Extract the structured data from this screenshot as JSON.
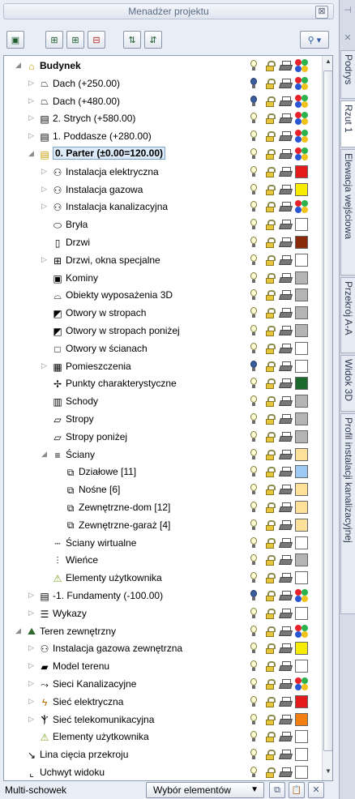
{
  "panel": {
    "title": "Menadżer projektu",
    "close_glyph": "⊠"
  },
  "toolbar": {
    "buttons": [
      "properties-icon",
      "add-green-icon",
      "add-blue-icon",
      "remove-red-icon",
      "move-up-icon",
      "move-down-icon",
      "filter-icon"
    ]
  },
  "tree": {
    "rows": [
      {
        "label": "Budynek",
        "level": 0,
        "toggle": "◢",
        "bold": true,
        "icon": "house-icon",
        "bulb": "yellow",
        "color": "multi"
      },
      {
        "label": "Dach (+250.00)",
        "level": 1,
        "toggle": "▷",
        "icon": "roof-icon",
        "bulb": "blue",
        "color": "multi"
      },
      {
        "label": "Dach (+480.00)",
        "level": 1,
        "toggle": "▷",
        "icon": "roof-icon",
        "bulb": "blue",
        "color": "multi"
      },
      {
        "label": "2. Strych (+580.00)",
        "level": 1,
        "toggle": "▷",
        "icon": "floor-icon",
        "bulb": "yellow",
        "color": "multi"
      },
      {
        "label": "1. Poddasze (+280.00)",
        "level": 1,
        "toggle": "▷",
        "icon": "floor-icon",
        "bulb": "yellow",
        "color": "multi"
      },
      {
        "label": "0. Parter (±0.00=120.00)",
        "level": 1,
        "toggle": "◢",
        "bold": true,
        "selected": true,
        "icon": "floor-active-icon",
        "bulb": "yellow",
        "color": "multi"
      },
      {
        "label": "Instalacja elektryczna",
        "level": 2,
        "toggle": "▷",
        "icon": "installation-icon",
        "bulb": "yellow",
        "color": "#e41b1b"
      },
      {
        "label": "Instalacja gazowa",
        "level": 2,
        "toggle": "▷",
        "icon": "installation-icon",
        "bulb": "yellow",
        "color": "#f7ec00"
      },
      {
        "label": "Instalacja kanalizacyjna",
        "level": 2,
        "toggle": "▷",
        "icon": "installation-icon",
        "bulb": "yellow",
        "color": "multi"
      },
      {
        "label": "Bryła",
        "level": 2,
        "toggle": "",
        "icon": "solid-icon",
        "bulb": "yellow",
        "color": "#ffffff"
      },
      {
        "label": "Drzwi",
        "level": 2,
        "toggle": "",
        "icon": "door-icon",
        "bulb": "yellow",
        "color": "#8a2a0a"
      },
      {
        "label": "Drzwi, okna specjalne",
        "level": 2,
        "toggle": "▷",
        "icon": "window-icon",
        "bulb": "yellow",
        "color": "#ffffff"
      },
      {
        "label": "Kominy",
        "level": 2,
        "toggle": "",
        "icon": "chimney-icon",
        "bulb": "yellow",
        "color": "#b4b4b4"
      },
      {
        "label": "Obiekty wyposażenia 3D",
        "level": 2,
        "toggle": "",
        "icon": "furniture-icon",
        "bulb": "yellow",
        "color": "#b4b4b4"
      },
      {
        "label": "Otwory w stropach",
        "level": 2,
        "toggle": "",
        "icon": "slab-opening-icon",
        "bulb": "yellow",
        "color": "#b4b4b4"
      },
      {
        "label": "Otwory w stropach poniżej",
        "level": 2,
        "toggle": "",
        "icon": "slab-opening-below-icon",
        "bulb": "yellow",
        "color": "#b4b4b4"
      },
      {
        "label": "Otwory w ścianach",
        "level": 2,
        "toggle": "",
        "icon": "wall-opening-icon",
        "bulb": "yellow",
        "color": "#ffffff"
      },
      {
        "label": "Pomieszczenia",
        "level": 2,
        "toggle": "▷",
        "icon": "rooms-icon",
        "bulb": "blue",
        "color": "#ffffff"
      },
      {
        "label": "Punkty charakterystyczne",
        "level": 2,
        "toggle": "",
        "icon": "points-icon",
        "bulb": "yellow",
        "color": "#1c6a2c"
      },
      {
        "label": "Schody",
        "level": 2,
        "toggle": "",
        "icon": "stairs-icon",
        "bulb": "yellow",
        "color": "#b4b4b4"
      },
      {
        "label": "Stropy",
        "level": 2,
        "toggle": "",
        "icon": "slab-icon",
        "bulb": "yellow",
        "color": "#b4b4b4"
      },
      {
        "label": "Stropy poniżej",
        "level": 2,
        "toggle": "",
        "icon": "slab-below-icon",
        "bulb": "yellow",
        "color": "#b4b4b4"
      },
      {
        "label": "Ściany",
        "level": 2,
        "toggle": "◢",
        "icon": "walls-icon",
        "bulb": "yellow",
        "color": "#fde09a"
      },
      {
        "label": "Działowe [11]",
        "level": 3,
        "toggle": "",
        "icon": "wall-type-icon",
        "bulb": "yellow",
        "color": "#9cc8f4"
      },
      {
        "label": "Nośne [6]",
        "level": 3,
        "toggle": "",
        "icon": "wall-type-icon",
        "bulb": "yellow",
        "color": "#fde09a"
      },
      {
        "label": "Zewnętrzne-dom [12]",
        "level": 3,
        "toggle": "",
        "icon": "wall-type-icon",
        "bulb": "yellow",
        "color": "#fde09a"
      },
      {
        "label": "Zewnętrzne-garaż [4]",
        "level": 3,
        "toggle": "",
        "icon": "wall-type-icon",
        "bulb": "yellow",
        "color": "#fde09a"
      },
      {
        "label": "Ściany wirtualne",
        "level": 2,
        "toggle": "",
        "icon": "virtual-wall-icon",
        "bulb": "yellow",
        "color": "#ffffff"
      },
      {
        "label": "Wieńce",
        "level": 2,
        "toggle": "",
        "icon": "ring-beam-icon",
        "bulb": "yellow",
        "color": "#b4b4b4"
      },
      {
        "label": "Elementy użytkownika",
        "level": 2,
        "toggle": "",
        "icon": "user-elements-icon",
        "bulb": "yellow",
        "color": "#ffffff"
      },
      {
        "label": "-1. Fundamenty (-100.00)",
        "level": 1,
        "toggle": "▷",
        "icon": "floor-icon",
        "bulb": "blue",
        "color": "multi"
      },
      {
        "label": "Wykazy",
        "level": 1,
        "toggle": "▷",
        "icon": "lists-icon",
        "bulb": "yellow",
        "color": "#ffffff"
      },
      {
        "label": "Teren zewnętrzny",
        "level": 0,
        "toggle": "◢",
        "icon": "terrain-icon",
        "bulb": "yellow",
        "color": "multi"
      },
      {
        "label": "Instalacja gazowa zewnętrzna",
        "level": 1,
        "toggle": "▷",
        "icon": "installation-icon",
        "bulb": "yellow",
        "color": "#f7ec00"
      },
      {
        "label": "Model terenu",
        "level": 1,
        "toggle": "▷",
        "icon": "terrain-model-icon",
        "bulb": "yellow",
        "color": "#ffffff"
      },
      {
        "label": "Sieci Kanalizacyjne",
        "level": 1,
        "toggle": "▷",
        "icon": "sewer-network-icon",
        "bulb": "yellow",
        "color": "multi"
      },
      {
        "label": "Sieć elektryczna",
        "level": 1,
        "toggle": "▷",
        "icon": "electric-network-icon",
        "bulb": "yellow",
        "color": "#e41b1b"
      },
      {
        "label": "Sieć telekomunikacyjna",
        "level": 1,
        "toggle": "▷",
        "icon": "telecom-network-icon",
        "bulb": "yellow",
        "color": "#f07f10"
      },
      {
        "label": "Elementy użytkownika",
        "level": 1,
        "toggle": "",
        "icon": "user-elements-icon",
        "bulb": "yellow",
        "color": "#ffffff"
      },
      {
        "label": "Lina cięcia przekroju",
        "level": 0,
        "toggle": "",
        "icon": "section-line-icon",
        "bulb": "yellow",
        "color": "#ffffff"
      },
      {
        "label": "Uchwyt widoku",
        "level": 0,
        "toggle": "",
        "icon": "view-handle-icon",
        "bulb": "yellow",
        "color": "#ffffff"
      }
    ]
  },
  "bottom": {
    "multi_clipboard": "Multi-schowek",
    "selection_mode": "Wybór elementów",
    "dropdown_arrow": "▼",
    "copy_glyph": "⧉",
    "paste_glyph": "📋",
    "delete_glyph": "✕"
  },
  "side_tabs": {
    "pin_glyph": "⊣",
    "close_glyph": "✕",
    "tabs": [
      "Podrys",
      "Rzut 1",
      "Elewacja wejściowa",
      "Przekrój A-A",
      "Widok 3D",
      "Profil instalacji kanalizacyjnej"
    ]
  }
}
